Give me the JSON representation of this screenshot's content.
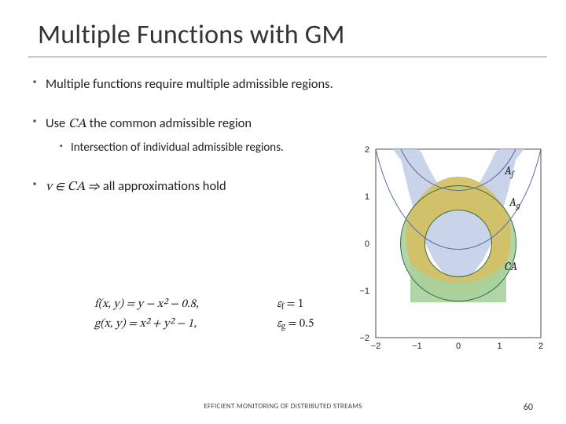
{
  "title": "Multiple Functions with GM",
  "bullets": {
    "b1": "Multiple functions require multiple admissible regions.",
    "b2_pre": "Use ",
    "b2_mid": "CA",
    "b2_post": " the common admissible region",
    "b2_sub": "Intersection of individual admissible regions.",
    "b3_pre": "v ∈ CA ⇒ ",
    "b3_post": "all approximations hold"
  },
  "equations": {
    "f_lhs": "f(x, y) = y − x² − 0.8,",
    "g_lhs": "g(x, y) = x² + y² − 1,",
    "ef_label": "ε_f",
    "ef_val": " = 1",
    "eg_label": "ε_g",
    "eg_val": " = 0.5"
  },
  "figure": {
    "labels": {
      "Af": "A_f",
      "Ag": "A_g",
      "CA": "CA"
    },
    "ticks_x": [
      "−2",
      "−1",
      "0",
      "1",
      "2"
    ],
    "ticks_y": [
      "−2",
      "−1",
      "0",
      "1",
      "2"
    ]
  },
  "footer": {
    "center": "EFFICIENT MONITORING OF DISTRIBUTED STREAMS",
    "page": "60"
  },
  "chart_data": {
    "type": "area",
    "title": "",
    "xlabel": "",
    "ylabel": "",
    "xlim": [
      -2,
      2
    ],
    "ylim": [
      -2,
      2
    ],
    "regions": [
      {
        "name": "A_f",
        "definition": "y - x^2 - 0.8 within eps_f=1 → -0.2 ≤ y - x^2 ≤ 1.8",
        "color": "#bcc8e6"
      },
      {
        "name": "A_g",
        "definition": "x^2 + y^2 - 1 within eps_g=0.5 → 0.5 ≤ x^2+y^2 ≤ 1.5 (annulus)",
        "color": "#a9d4a0"
      },
      {
        "name": "CA",
        "definition": "A_f ∩ A_g",
        "color": "#d4c06a"
      }
    ],
    "functions": [
      {
        "name": "f(x,y)",
        "expr": "y - x^2 - 0.8",
        "eps": 1
      },
      {
        "name": "g(x,y)",
        "expr": "x^2 + y^2 - 1",
        "eps": 0.5
      }
    ]
  }
}
